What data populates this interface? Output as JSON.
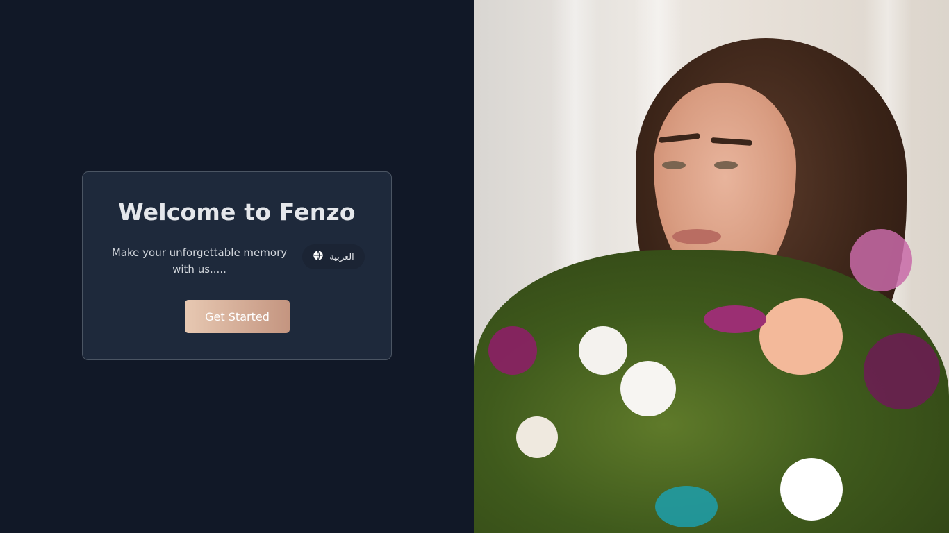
{
  "welcome_card": {
    "title": "Welcome to Fenzo",
    "tagline": "Make your unforgettable memory with us.....",
    "language_button_label": "العربية",
    "cta_label": "Get Started"
  },
  "hero_image": {
    "alt": "Woman holding a bouquet of flowers"
  },
  "colors": {
    "background": "#111827",
    "card": "#1e293b",
    "cta_gradient_start": "#e7c8b2",
    "cta_gradient_end": "#c49580"
  },
  "icons": {
    "language": "globe-icon"
  }
}
